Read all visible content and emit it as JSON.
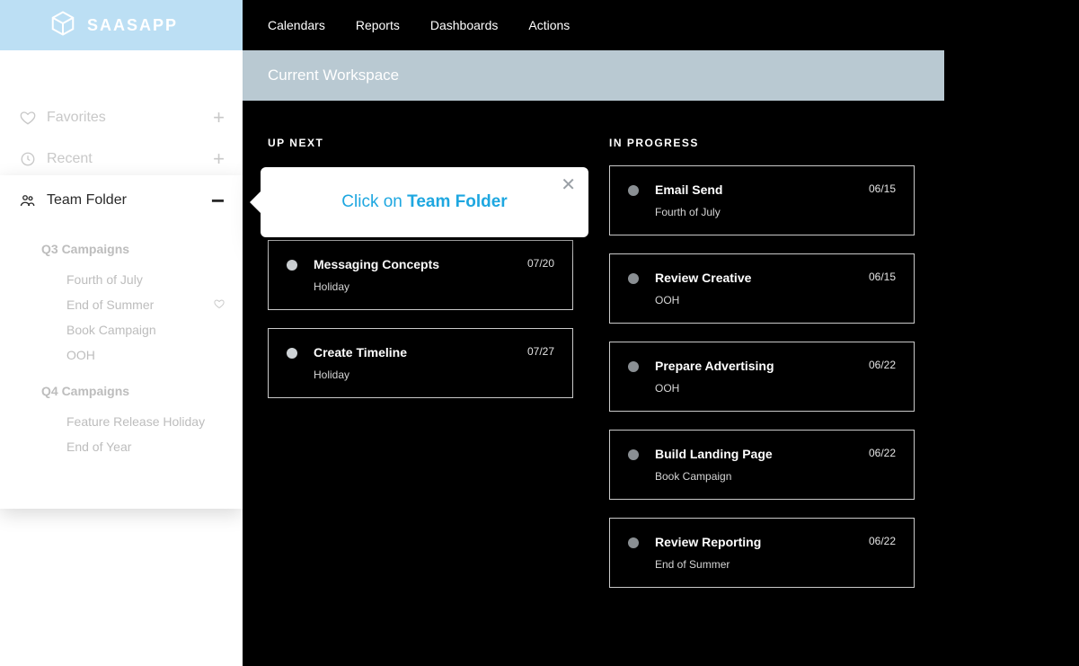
{
  "logo": {
    "text": "SAASAPP"
  },
  "topnav": [
    "Calendars",
    "Reports",
    "Dashboards",
    "Actions"
  ],
  "workspace_title": "Current Workspace",
  "sidebar": {
    "favorites_label": "Favorites",
    "recent_label": "Recent",
    "team_folder_label": "Team Folder",
    "groups": [
      {
        "title": "Q3 Campaigns",
        "items": [
          {
            "label": "Fourth of July",
            "fav": false
          },
          {
            "label": "End of Summer",
            "fav": true
          },
          {
            "label": "Book Campaign",
            "fav": false
          },
          {
            "label": "OOH",
            "fav": false
          }
        ]
      },
      {
        "title": "Q4 Campaigns",
        "items": [
          {
            "label": "Feature Release Holiday",
            "fav": false
          },
          {
            "label": "End of Year",
            "fav": false
          }
        ]
      }
    ]
  },
  "popover": {
    "text_a": "Click on ",
    "text_b": "Team Folder"
  },
  "columns": {
    "up_next": {
      "heading": "UP NEXT",
      "cards": [
        {
          "title": "",
          "sub": "",
          "date": ""
        },
        {
          "title": "Messaging Concepts",
          "sub": "Holiday",
          "date": "07/20"
        },
        {
          "title": "Create Timeline",
          "sub": "Holiday",
          "date": "07/27"
        }
      ]
    },
    "in_progress": {
      "heading": "IN PROGRESS",
      "cards": [
        {
          "title": "Email Send",
          "sub": "Fourth of July",
          "date": "06/15"
        },
        {
          "title": "Review Creative",
          "sub": "OOH",
          "date": "06/15"
        },
        {
          "title": "Prepare Advertising",
          "sub": "OOH",
          "date": "06/22"
        },
        {
          "title": "Build Landing Page",
          "sub": "Book Campaign",
          "date": "06/22"
        },
        {
          "title": "Review Reporting",
          "sub": "End of Summer",
          "date": "06/22"
        }
      ]
    }
  }
}
